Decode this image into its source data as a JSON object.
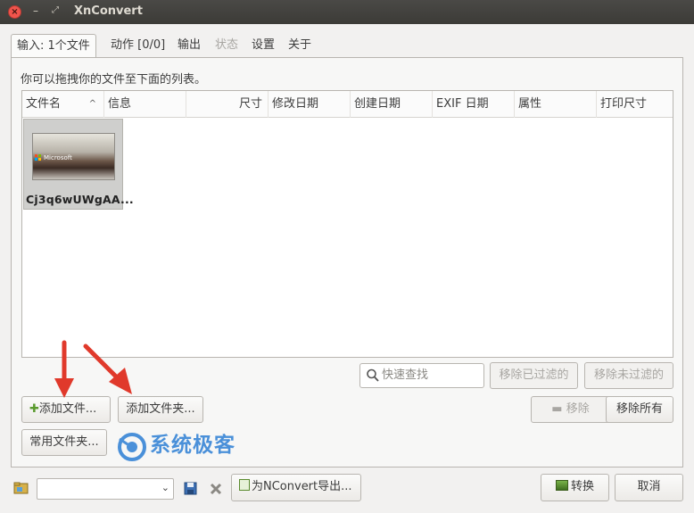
{
  "window": {
    "title": "XnConvert",
    "close_glyph": "×",
    "min_glyph": "–",
    "max_glyph": "⤢"
  },
  "tabs": [
    {
      "label": "输入: 1个文件",
      "state": "active"
    },
    {
      "label": "动作 [0/0]",
      "state": "normal"
    },
    {
      "label": "输出",
      "state": "normal"
    },
    {
      "label": "状态",
      "state": "disabled"
    },
    {
      "label": "设置",
      "state": "normal"
    },
    {
      "label": "关于",
      "state": "normal"
    }
  ],
  "input": {
    "hint": "你可以拖拽你的文件至下面的列表。",
    "columns": [
      "文件名",
      "信息",
      "尺寸",
      "修改日期",
      "创建日期",
      "EXIF 日期",
      "属性",
      "打印尺寸"
    ],
    "sort_indicator": "^",
    "files": [
      {
        "name": "Cj3q6wUWgAA...",
        "thumb_caption": "Microsoft"
      }
    ],
    "search_placeholder": "快速查找",
    "remove_filtered": "移除已过滤的",
    "remove_unfiltered": "移除未过滤的",
    "add_files": "添加文件...",
    "add_folder": "添加文件夹...",
    "remove": "移除",
    "remove_all": "移除所有",
    "common_folders": "常用文件夹..."
  },
  "watermark": {
    "text": "系统极客"
  },
  "bottom": {
    "preset_value": "",
    "export_nconvert": "为NConvert导出...",
    "convert": "转换",
    "cancel": "取消"
  },
  "colors": {
    "arrow": "#e0392b",
    "watermark": "#4a90d9",
    "close": "#f0544c"
  }
}
